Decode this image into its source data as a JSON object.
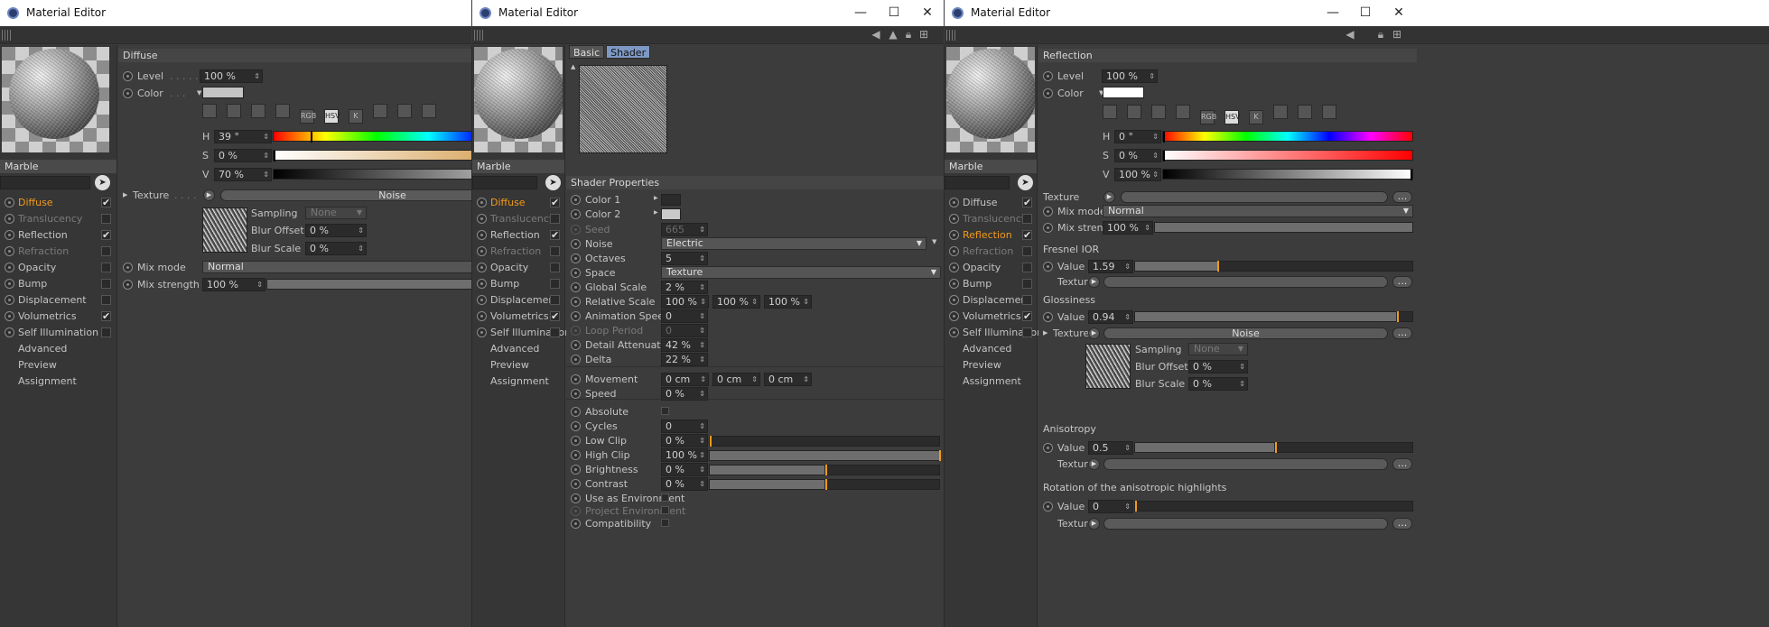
{
  "windows": [
    {
      "title": "Material Editor",
      "material_name": "Marble",
      "channels": [
        {
          "label": "Diffuse",
          "checked": true,
          "state": "active"
        },
        {
          "label": "Translucency",
          "checked": false,
          "state": "dim"
        },
        {
          "label": "Reflection",
          "checked": true,
          "state": "normal"
        },
        {
          "label": "Refraction",
          "checked": false,
          "state": "dim"
        },
        {
          "label": "Opacity",
          "checked": false,
          "state": "normal"
        },
        {
          "label": "Bump",
          "checked": false,
          "state": "normal"
        },
        {
          "label": "Displacement",
          "checked": false,
          "state": "normal"
        },
        {
          "label": "Volumetrics",
          "checked": true,
          "state": "normal"
        },
        {
          "label": "Self Illumination",
          "checked": false,
          "state": "normal"
        },
        {
          "label": "Advanced",
          "checked": null,
          "state": "plain"
        },
        {
          "label": "Preview",
          "checked": null,
          "state": "plain"
        },
        {
          "label": "Assignment",
          "checked": null,
          "state": "plain"
        }
      ],
      "section": "Diffuse",
      "level_label": "Level",
      "level": "100 %",
      "color_label": "Color",
      "color_swatch": "#c4c4c4",
      "icon_names": [
        "image-icon",
        "wheel-icon",
        "square-icon",
        "picture-icon",
        "rgb-icon",
        "hsv-icon",
        "k-icon",
        "mixer-icon",
        "spectrum-icon",
        "eyedropper-icon"
      ],
      "icon_labels": [
        "",
        "",
        "",
        "",
        "RGB",
        "HSV",
        "K",
        "",
        "",
        ""
      ],
      "h_label": "H",
      "h": "39 °",
      "s_label": "S",
      "s": "0 %",
      "v_label": "V",
      "v": "70 %",
      "h_frac": 0.12,
      "s_frac": 0.0,
      "v_frac": 0.7,
      "texture_label": "Texture",
      "texture_name": "Noise",
      "more": "...",
      "sampling_label": "Sampling",
      "sampling": "None",
      "blur_offset_label": "Blur Offset",
      "blur_offset": "0 %",
      "blur_scale_label": "Blur Scale",
      "blur_scale": "0 %",
      "mix_mode_label": "Mix mode",
      "mix_mode": "Normal",
      "mix_strength_label": "Mix strength",
      "mix_strength": "100 %",
      "mix_strength_frac": 1.0
    },
    {
      "title": "Material Editor",
      "material_name": "Marble",
      "channels": [
        {
          "label": "Diffuse",
          "checked": true,
          "state": "active"
        },
        {
          "label": "Translucency",
          "checked": false,
          "state": "dim"
        },
        {
          "label": "Reflection",
          "checked": true,
          "state": "normal"
        },
        {
          "label": "Refraction",
          "checked": false,
          "state": "dim"
        },
        {
          "label": "Opacity",
          "checked": false,
          "state": "normal"
        },
        {
          "label": "Bump",
          "checked": false,
          "state": "normal"
        },
        {
          "label": "Displacement",
          "checked": false,
          "state": "normal"
        },
        {
          "label": "Volumetrics",
          "checked": true,
          "state": "normal"
        },
        {
          "label": "Self Illumination",
          "checked": false,
          "state": "normal"
        },
        {
          "label": "Advanced",
          "checked": null,
          "state": "plain"
        },
        {
          "label": "Preview",
          "checked": null,
          "state": "plain"
        },
        {
          "label": "Assignment",
          "checked": null,
          "state": "plain"
        }
      ],
      "tabs": [
        {
          "label": "Basic",
          "active": false
        },
        {
          "label": "Shader",
          "active": true
        }
      ],
      "section": "Shader Properties",
      "color1_label": "Color 1",
      "color1": "#2b2b2b",
      "color2_label": "Color 2",
      "color2": "#c9c9c9",
      "seed_label": "Seed",
      "seed": "665",
      "noise_label": "Noise",
      "noise": "Electric",
      "octaves_label": "Octaves",
      "octaves": "5",
      "space_label": "Space",
      "space": "Texture",
      "global_scale_label": "Global Scale",
      "global_scale": "2 %",
      "relative_scale_label": "Relative Scale",
      "relative_scale": [
        "100 %",
        "100 %",
        "100 %"
      ],
      "animation_speed_label": "Animation Speed",
      "animation_speed": "0",
      "loop_period_label": "Loop Period",
      "loop_period": "0",
      "detail_attenuation_label": "Detail Attenuation",
      "detail_attenuation": "42 %",
      "delta_label": "Delta",
      "delta": "22 %",
      "movement_label": "Movement",
      "movement": [
        "0 cm",
        "0 cm",
        "0 cm"
      ],
      "speed_label": "Speed",
      "speed": "0 %",
      "absolute_label": "Absolute",
      "cycles_label": "Cycles",
      "cycles": "0",
      "low_clip_label": "Low Clip",
      "low_clip": "0 %",
      "low_clip_frac": 0.0,
      "high_clip_label": "High Clip",
      "high_clip": "100 %",
      "high_clip_frac": 1.0,
      "brightness_label": "Brightness",
      "brightness": "0 %",
      "brightness_frac": 0.5,
      "contrast_label": "Contrast",
      "contrast": "0 %",
      "contrast_frac": 0.5,
      "use_env_label": "Use as Environment",
      "project_env_label": "Project Environment",
      "compat_label": "Compatibility"
    },
    {
      "title": "Material Editor",
      "material_name": "Marble",
      "channels": [
        {
          "label": "Diffuse",
          "checked": true,
          "state": "normal"
        },
        {
          "label": "Translucency",
          "checked": false,
          "state": "dim"
        },
        {
          "label": "Reflection",
          "checked": true,
          "state": "active"
        },
        {
          "label": "Refraction",
          "checked": false,
          "state": "dim"
        },
        {
          "label": "Opacity",
          "checked": false,
          "state": "normal"
        },
        {
          "label": "Bump",
          "checked": false,
          "state": "normal"
        },
        {
          "label": "Displacement",
          "checked": false,
          "state": "normal"
        },
        {
          "label": "Volumetrics",
          "checked": true,
          "state": "normal"
        },
        {
          "label": "Self Illumination",
          "checked": false,
          "state": "normal"
        },
        {
          "label": "Advanced",
          "checked": null,
          "state": "plain"
        },
        {
          "label": "Preview",
          "checked": null,
          "state": "plain"
        },
        {
          "label": "Assignment",
          "checked": null,
          "state": "plain"
        }
      ],
      "section": "Reflection",
      "level_label": "Level",
      "level": "100 %",
      "color_label": "Color",
      "color_swatch": "#ffffff",
      "icon_names": [
        "image-icon",
        "wheel-icon",
        "square-icon",
        "picture-icon",
        "rgb-icon",
        "hsv-icon",
        "k-icon",
        "mixer-icon",
        "spectrum-icon",
        "eyedropper-icon"
      ],
      "icon_labels": [
        "",
        "",
        "",
        "",
        "RGB",
        "HSV",
        "K",
        "",
        "",
        ""
      ],
      "h_label": "H",
      "h": "0 °",
      "s_label": "S",
      "s": "0 %",
      "v_label": "V",
      "v": "100 %",
      "h_frac": 0.0,
      "s_frac": 0.0,
      "v_frac": 1.0,
      "texture_label": "Texture",
      "mix_mode_label": "Mix mode",
      "mix_mode": "Normal",
      "mix_strength_label": "Mix strength",
      "mix_strength": "100 %",
      "mix_strength_frac": 1.0,
      "fresnel_head": "Fresnel IOR",
      "fresnel_value_label": "Value",
      "fresnel_value": "1.59",
      "fresnel_frac": 0.295,
      "glossiness_head": "Glossiness",
      "gloss_value_label": "Value",
      "gloss_value": "0.94",
      "gloss_frac": 0.94,
      "gloss_texture_name": "Noise",
      "sampling_label": "Sampling",
      "sampling": "None",
      "blur_offset_label": "Blur Offset",
      "blur_offset": "0 %",
      "blur_scale_label": "Blur Scale",
      "blur_scale": "0 %",
      "anisotropy_head": "Anisotropy",
      "aniso_value_label": "Value",
      "aniso_value": "0.5",
      "aniso_frac": 0.5,
      "rotation_head": "Rotation of the anisotropic highlights",
      "rot_value_label": "Value",
      "rot_value": "0",
      "rot_frac": 0.0,
      "more": "..."
    }
  ],
  "window_controls": {
    "minimize": "—",
    "maximize": "☐",
    "close": "✕"
  }
}
